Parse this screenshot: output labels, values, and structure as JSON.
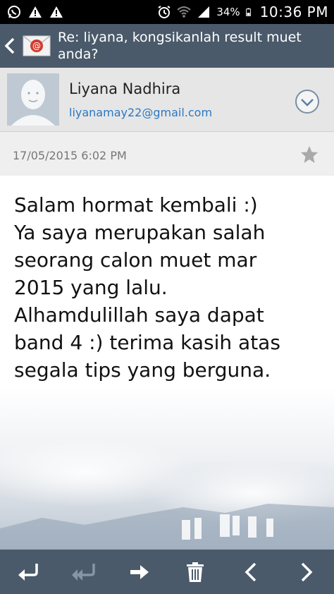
{
  "status_bar": {
    "battery_percent": "34%",
    "time": "10:36 PM"
  },
  "header": {
    "subject": "Re: liyana, kongsikanlah result muet anda?"
  },
  "sender": {
    "name": "Liyana Nadhira",
    "email": "liyanamay22@gmail.com"
  },
  "message": {
    "date": "17/05/2015  6:02 PM",
    "lines": [
      "Salam hormat kembali :)",
      "Ya saya merupakan salah",
      "seorang calon muet mar",
      "2015 yang lalu.",
      "Alhamdulillah saya dapat",
      "band 4 :) terima kasih atas",
      "segala tips yang berguna."
    ]
  },
  "colors": {
    "action_bar": "#4a5a6a",
    "link": "#2b78c2"
  }
}
